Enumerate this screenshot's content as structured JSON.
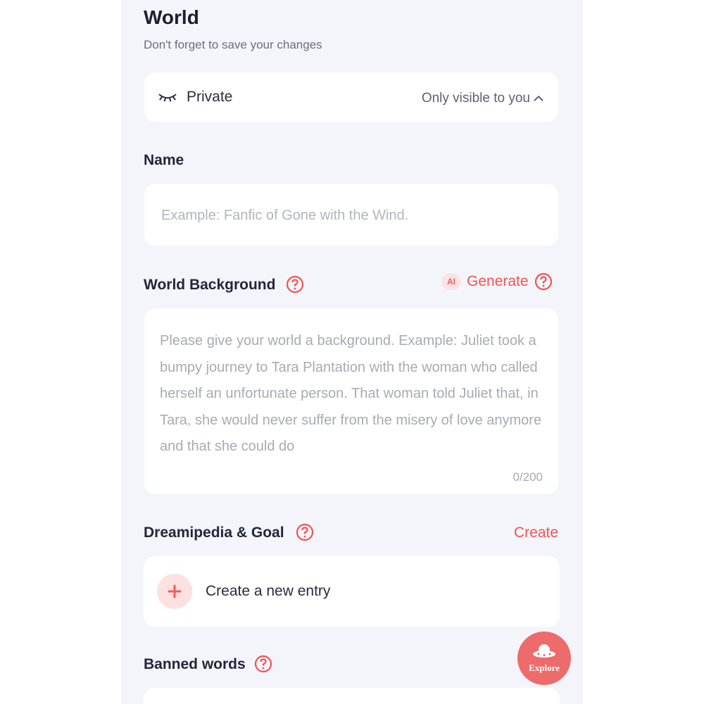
{
  "header": {
    "title": "World",
    "subtitle": "Don't forget to save your changes"
  },
  "privacy": {
    "icon": "closed-eye-icon",
    "label": "Private",
    "visibility": "Only visible to you"
  },
  "name_field": {
    "label": "Name",
    "placeholder": "Example: Fanfic of Gone with the Wind.",
    "value": ""
  },
  "world_background": {
    "label": "World Background",
    "generate_badge": "AI",
    "generate_label": "Generate",
    "placeholder": "Please give your world a background. Example: Juliet took a bumpy journey to Tara Plantation with the woman who called herself an unfortunate person. That woman told Juliet that, in Tara, she would never suffer from the misery of love anymore and that she could do",
    "counter": "0/200"
  },
  "dreamipedia": {
    "label": "Dreamipedia & Goal",
    "create_label": "Create",
    "new_entry_label": "Create a new entry"
  },
  "banned_words": {
    "label": "Banned words"
  },
  "explore": {
    "label": "Explore"
  },
  "colors": {
    "accent": "#ef5454",
    "panel_bg": "#f3f5fb",
    "explore_bg": "#ee6b6b"
  }
}
